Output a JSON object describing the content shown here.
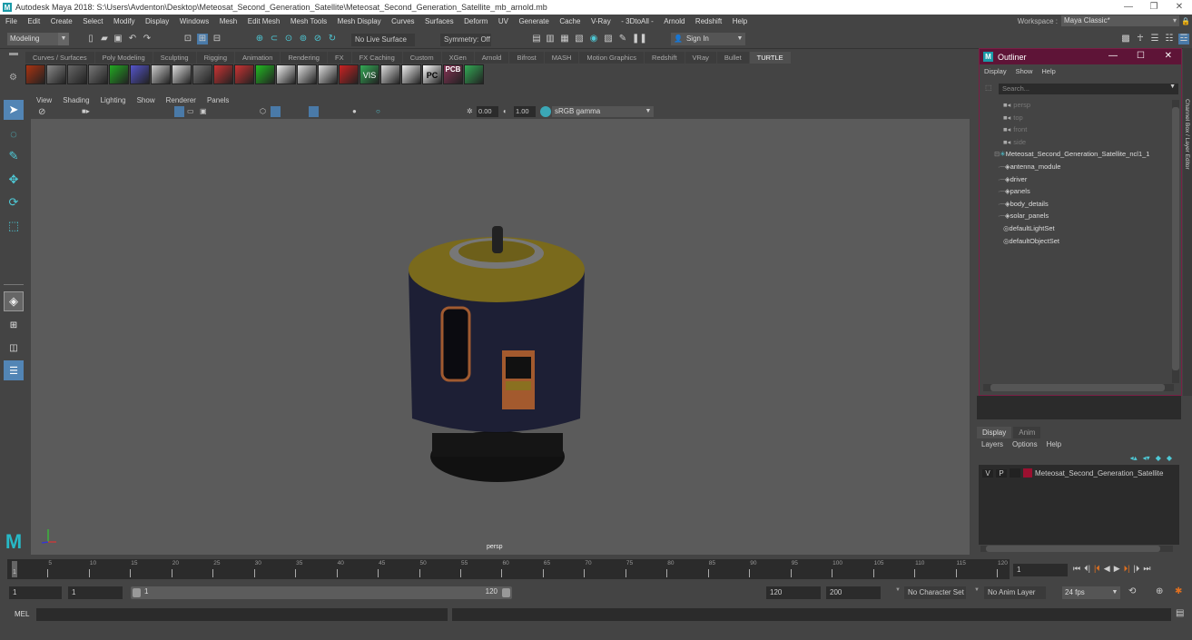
{
  "window": {
    "title": "Autodesk Maya 2018: S:\\Users\\Avdenton\\Desktop\\Meteosat_Second_Generation_Satellite\\Meteosat_Second_Generation_Satellite_mb_arnold.mb",
    "app_logo": "M",
    "minimize": "—",
    "maximize": "❐",
    "close": "✕"
  },
  "menubar": [
    "File",
    "Edit",
    "Create",
    "Select",
    "Modify",
    "Display",
    "Windows",
    "Mesh",
    "Edit Mesh",
    "Mesh Tools",
    "Mesh Display",
    "Curves",
    "Surfaces",
    "Deform",
    "UV",
    "Generate",
    "Cache",
    "V-Ray",
    "- 3DtoAll -",
    "Arnold",
    "Redshift",
    "Help"
  ],
  "workspace": {
    "label": "Workspace :",
    "value": "Maya Classic*"
  },
  "statusline": {
    "mode": "Modeling",
    "live_surface": "No Live Surface",
    "symmetry": "Symmetry: Off",
    "sign_in": "Sign In"
  },
  "shelf": {
    "tabs": [
      "Curves / Surfaces",
      "Poly Modeling",
      "Sculpting",
      "Rigging",
      "Animation",
      "Rendering",
      "FX",
      "FX Caching",
      "Custom",
      "XGen",
      "Arnold",
      "Bifrost",
      "MASH",
      "Motion Graphics",
      "Redshift",
      "VRay",
      "Bullet",
      "TURTLE"
    ],
    "active_tab": "TURTLE",
    "icons": [
      "fire-icon",
      "box-sphere-icon",
      "sphere-icon",
      "shaded-sphere-icon",
      "green-light-icon",
      "uv-grid-icon",
      "bake-icon",
      "surface-samples-icon",
      "ghost-icon",
      "red-box-icon",
      "red-box-2-icon",
      "green-sphere-icon",
      "blocks-icon",
      "white-sphere-icon",
      "torus-icon",
      "red-torus-icon",
      "hw-vis-icon",
      "no-bake-icon",
      "panel-icon",
      "pc-icon",
      "pcb-icon",
      "kw-vis-icon"
    ],
    "icon_labels": {
      "hw_vis": "VIS",
      "pc": "PC",
      "pcb": "PCB"
    }
  },
  "viewport": {
    "menu": [
      "View",
      "Shading",
      "Lighting",
      "Show",
      "Renderer",
      "Panels"
    ],
    "exposure": "0.00",
    "gamma": "1.00",
    "color_space": "sRGB gamma",
    "camera_label": "persp",
    "axis": {
      "x": "x",
      "y": "y",
      "z": "z"
    }
  },
  "outliner": {
    "title": "Outliner",
    "menu": [
      "Display",
      "Show",
      "Help"
    ],
    "search_placeholder": "Search...",
    "cameras": [
      "persp",
      "top",
      "front",
      "side"
    ],
    "root": "Meteosat_Second_Generation_Satellite_ncl1_1",
    "children": [
      "antenna_module",
      "driver",
      "panels",
      "body_details",
      "solar_panels"
    ],
    "sets": [
      "defaultLightSet",
      "defaultObjectSet"
    ]
  },
  "side_tab": "Channel Box / Layer Editor",
  "layer_editor": {
    "tabs": [
      "Display",
      "Anim"
    ],
    "active_tab": "Display",
    "menu": [
      "Layers",
      "Options",
      "Help"
    ],
    "layers": [
      {
        "v": "V",
        "p": "P",
        "color": "#9b1030",
        "name": "Meteosat_Second_Generation_Satellite"
      }
    ]
  },
  "timeline": {
    "ticks": [
      "5",
      "10",
      "15",
      "20",
      "25",
      "30",
      "35",
      "40",
      "45",
      "50",
      "55",
      "60",
      "65",
      "70",
      "75",
      "80",
      "85",
      "90",
      "95",
      "100",
      "105",
      "110",
      "115",
      "120"
    ],
    "current_frame_marker": "1",
    "current_frame": "1"
  },
  "range": {
    "start": "1",
    "playback_start": "1",
    "slider_min": "1",
    "slider_max": "120",
    "playback_end": "120",
    "end": "200",
    "character_set": "No Character Set",
    "anim_layer": "No Anim Layer",
    "fps": "24 fps"
  },
  "command_line": {
    "label": "MEL",
    "value": ""
  }
}
